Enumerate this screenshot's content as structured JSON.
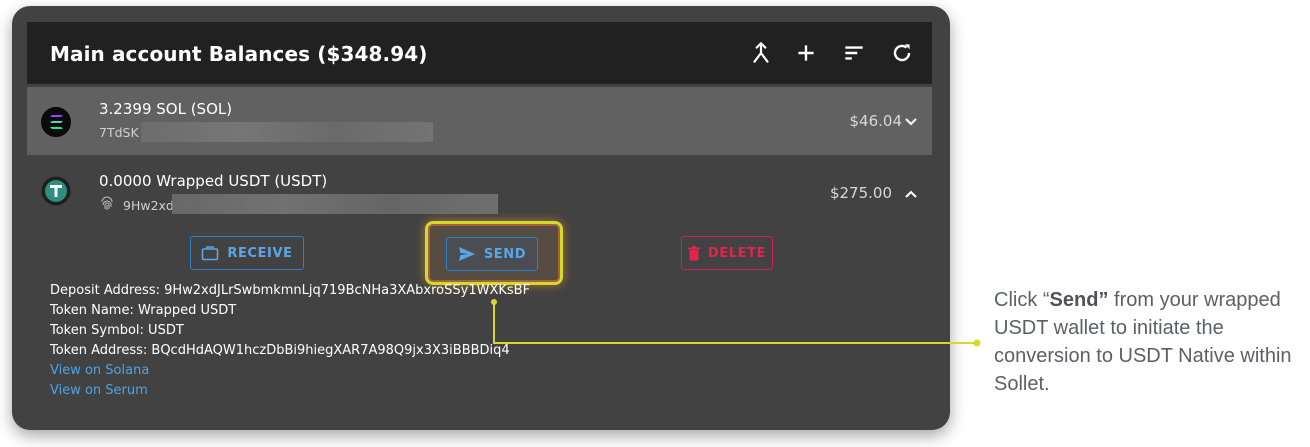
{
  "appbar": {
    "title": "Main account Balances ($348.94)",
    "icons": [
      "merge-icon",
      "add-icon",
      "sort-icon",
      "refresh-icon"
    ]
  },
  "tokens": [
    {
      "primary": "3.2399 SOL (SOL)",
      "address_prefix": "7TdSK",
      "value": "$46.04",
      "icon": "solana-logo-icon",
      "expanded": false
    },
    {
      "primary": "0.0000 Wrapped USDT (USDT)",
      "address_prefix": "9Hw2xd",
      "value": "$275.00",
      "icon": "usdt-logo-icon",
      "expanded": true
    }
  ],
  "actions": {
    "receive": "RECEIVE",
    "send": "SEND",
    "delete": "DELETE"
  },
  "details": {
    "deposit": "Deposit Address: 9Hw2xdJLrSwbmkmnLjq719BcNHa3XAbxroSSy1WXKsBF",
    "name": "Token Name: Wrapped USDT",
    "symbol": "Token Symbol: USDT",
    "address": "Token Address: BQcdHdAQW1hczDbBi9hiegXAR7A98Q9jx3X3iBBBDiq4",
    "view_solana": "View on Solana",
    "view_serum": "View on Serum"
  },
  "callout": {
    "prefix": "Click “",
    "bold": "Send”",
    "suffix": " from your wrapped USDT wallet to initiate the conversion to USDT Native within Sollet."
  },
  "colors": {
    "card_bg": "#424242",
    "appbar_bg": "#212121",
    "row_selected": "#616161",
    "link": "#4fa3e3",
    "delete": "#e2244f",
    "highlight": "#d7d92a"
  }
}
